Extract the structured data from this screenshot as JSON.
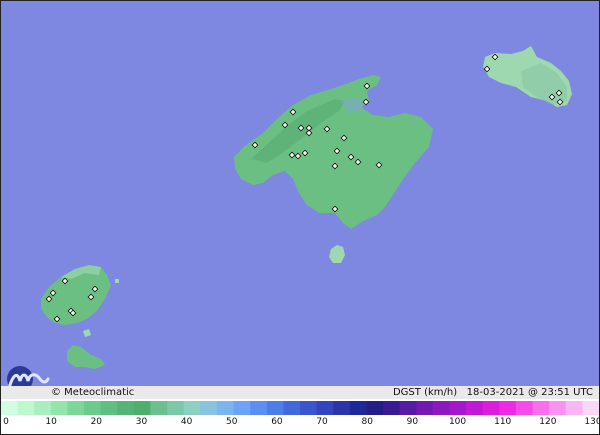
{
  "map": {
    "brand": "© Meteoclimatic",
    "variable": "DGST (km/h)",
    "date": "18-03-2021",
    "at": "@",
    "time": "23:51 UTC",
    "sea_color": "#7f88e0",
    "land_color": "#6bbf83",
    "land_light_color": "#9ed8b0",
    "islands": [
      "Mallorca",
      "Menorca",
      "Ibiza",
      "Formentera",
      "Cabrera"
    ]
  },
  "scale": {
    "ticks": [
      "0",
      "10",
      "20",
      "30",
      "40",
      "50",
      "60",
      "70",
      "80",
      "90",
      "100",
      "110",
      "120",
      "130"
    ],
    "colors": [
      "#cfffe0",
      "#bff7cf",
      "#a8efbd",
      "#93e5aa",
      "#7ed799",
      "#6ccb8b",
      "#5fbf80",
      "#55b476",
      "#4fb06e",
      "#6dbf8f",
      "#7cc8a8",
      "#8bd0c0",
      "#88c4e0",
      "#7ab5ef",
      "#6ba3f5",
      "#5b90f2",
      "#4d7ee8",
      "#4269dc",
      "#3a56cf",
      "#3245bd",
      "#2a36a8",
      "#1f2896",
      "#241d86",
      "#3a1a93",
      "#561aa3",
      "#7219b2",
      "#8c18c0",
      "#a517cd",
      "#c219d7",
      "#db1ddd",
      "#ef2ae4",
      "#f64be8",
      "#f86eeb",
      "#f993ef",
      "#fab6f3",
      "#fbd6f7"
    ]
  }
}
